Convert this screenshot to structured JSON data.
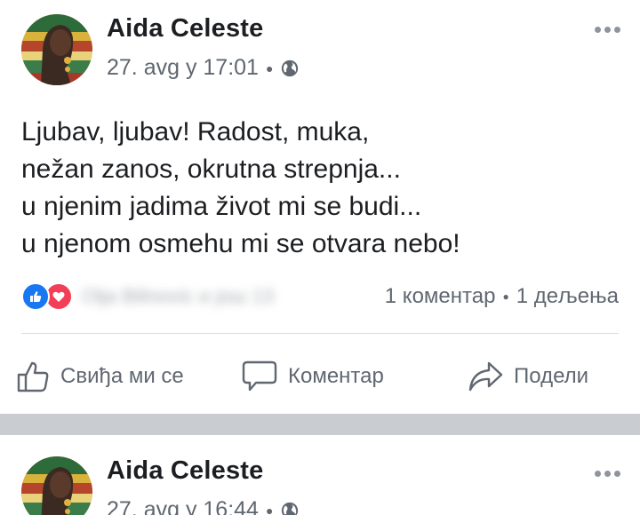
{
  "posts": [
    {
      "author": "Aida Celeste",
      "timestamp": "27. avg у 17:01",
      "privacy_icon": "globe-icon",
      "text_lines": [
        "Ljubav, ljubav! Radost, muka,",
        "nežan zanos, okrutna strepnja...",
        "u njenim jadima život mi se budi...",
        "u njenom osmehu mi se otvara nebo!"
      ],
      "reaction_icons": [
        "like-icon",
        "love-icon"
      ],
      "reaction_names": "Olja Bilinovic и још 13",
      "comments": "1 коментар",
      "shares": "1 дељења"
    },
    {
      "author": "Aida Celeste",
      "timestamp": "27. avg у 16:44",
      "privacy_icon": "globe-icon"
    }
  ],
  "actions": {
    "like": "Свиђа ми се",
    "comment": "Коментар",
    "share": "Подели"
  },
  "colors": {
    "like_blue": "#1877f2",
    "love_red": "#f33e58",
    "secondary_text": "#606770",
    "separator": "#c9ccd1"
  }
}
